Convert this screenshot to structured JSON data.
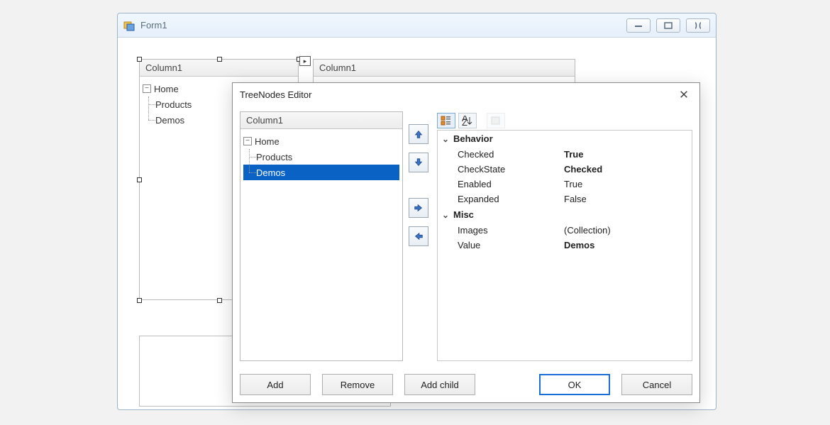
{
  "form": {
    "title": "Form1",
    "controls": {
      "left_tree": {
        "header": "Column1",
        "nodes": {
          "root": "Home",
          "children": [
            "Products",
            "Demos"
          ]
        }
      },
      "right_tree": {
        "header": "Column1"
      }
    }
  },
  "dialog": {
    "title": "TreeNodes Editor",
    "tree": {
      "header": "Column1",
      "root": "Home",
      "children": [
        "Products",
        "Demos"
      ],
      "selected_index": 1
    },
    "arrows": [
      "up",
      "down",
      "right",
      "left"
    ],
    "toolbar": {
      "categorized_icon": "categorized",
      "alpha_icon": "alpha-sort",
      "pages_icon": "property-pages"
    },
    "properties": {
      "categories": [
        {
          "name": "Behavior",
          "rows": [
            {
              "name": "Checked",
              "value": "True",
              "bold": true
            },
            {
              "name": "CheckState",
              "value": "Checked",
              "bold": true
            },
            {
              "name": "Enabled",
              "value": "True",
              "bold": false
            },
            {
              "name": "Expanded",
              "value": "False",
              "bold": false
            }
          ]
        },
        {
          "name": "Misc",
          "rows": [
            {
              "name": "Images",
              "value": "(Collection)",
              "bold": false
            },
            {
              "name": "Value",
              "value": "Demos",
              "bold": true
            }
          ]
        }
      ]
    },
    "buttons": {
      "add": "Add",
      "remove": "Remove",
      "add_child": "Add child",
      "ok": "OK",
      "cancel": "Cancel"
    }
  }
}
